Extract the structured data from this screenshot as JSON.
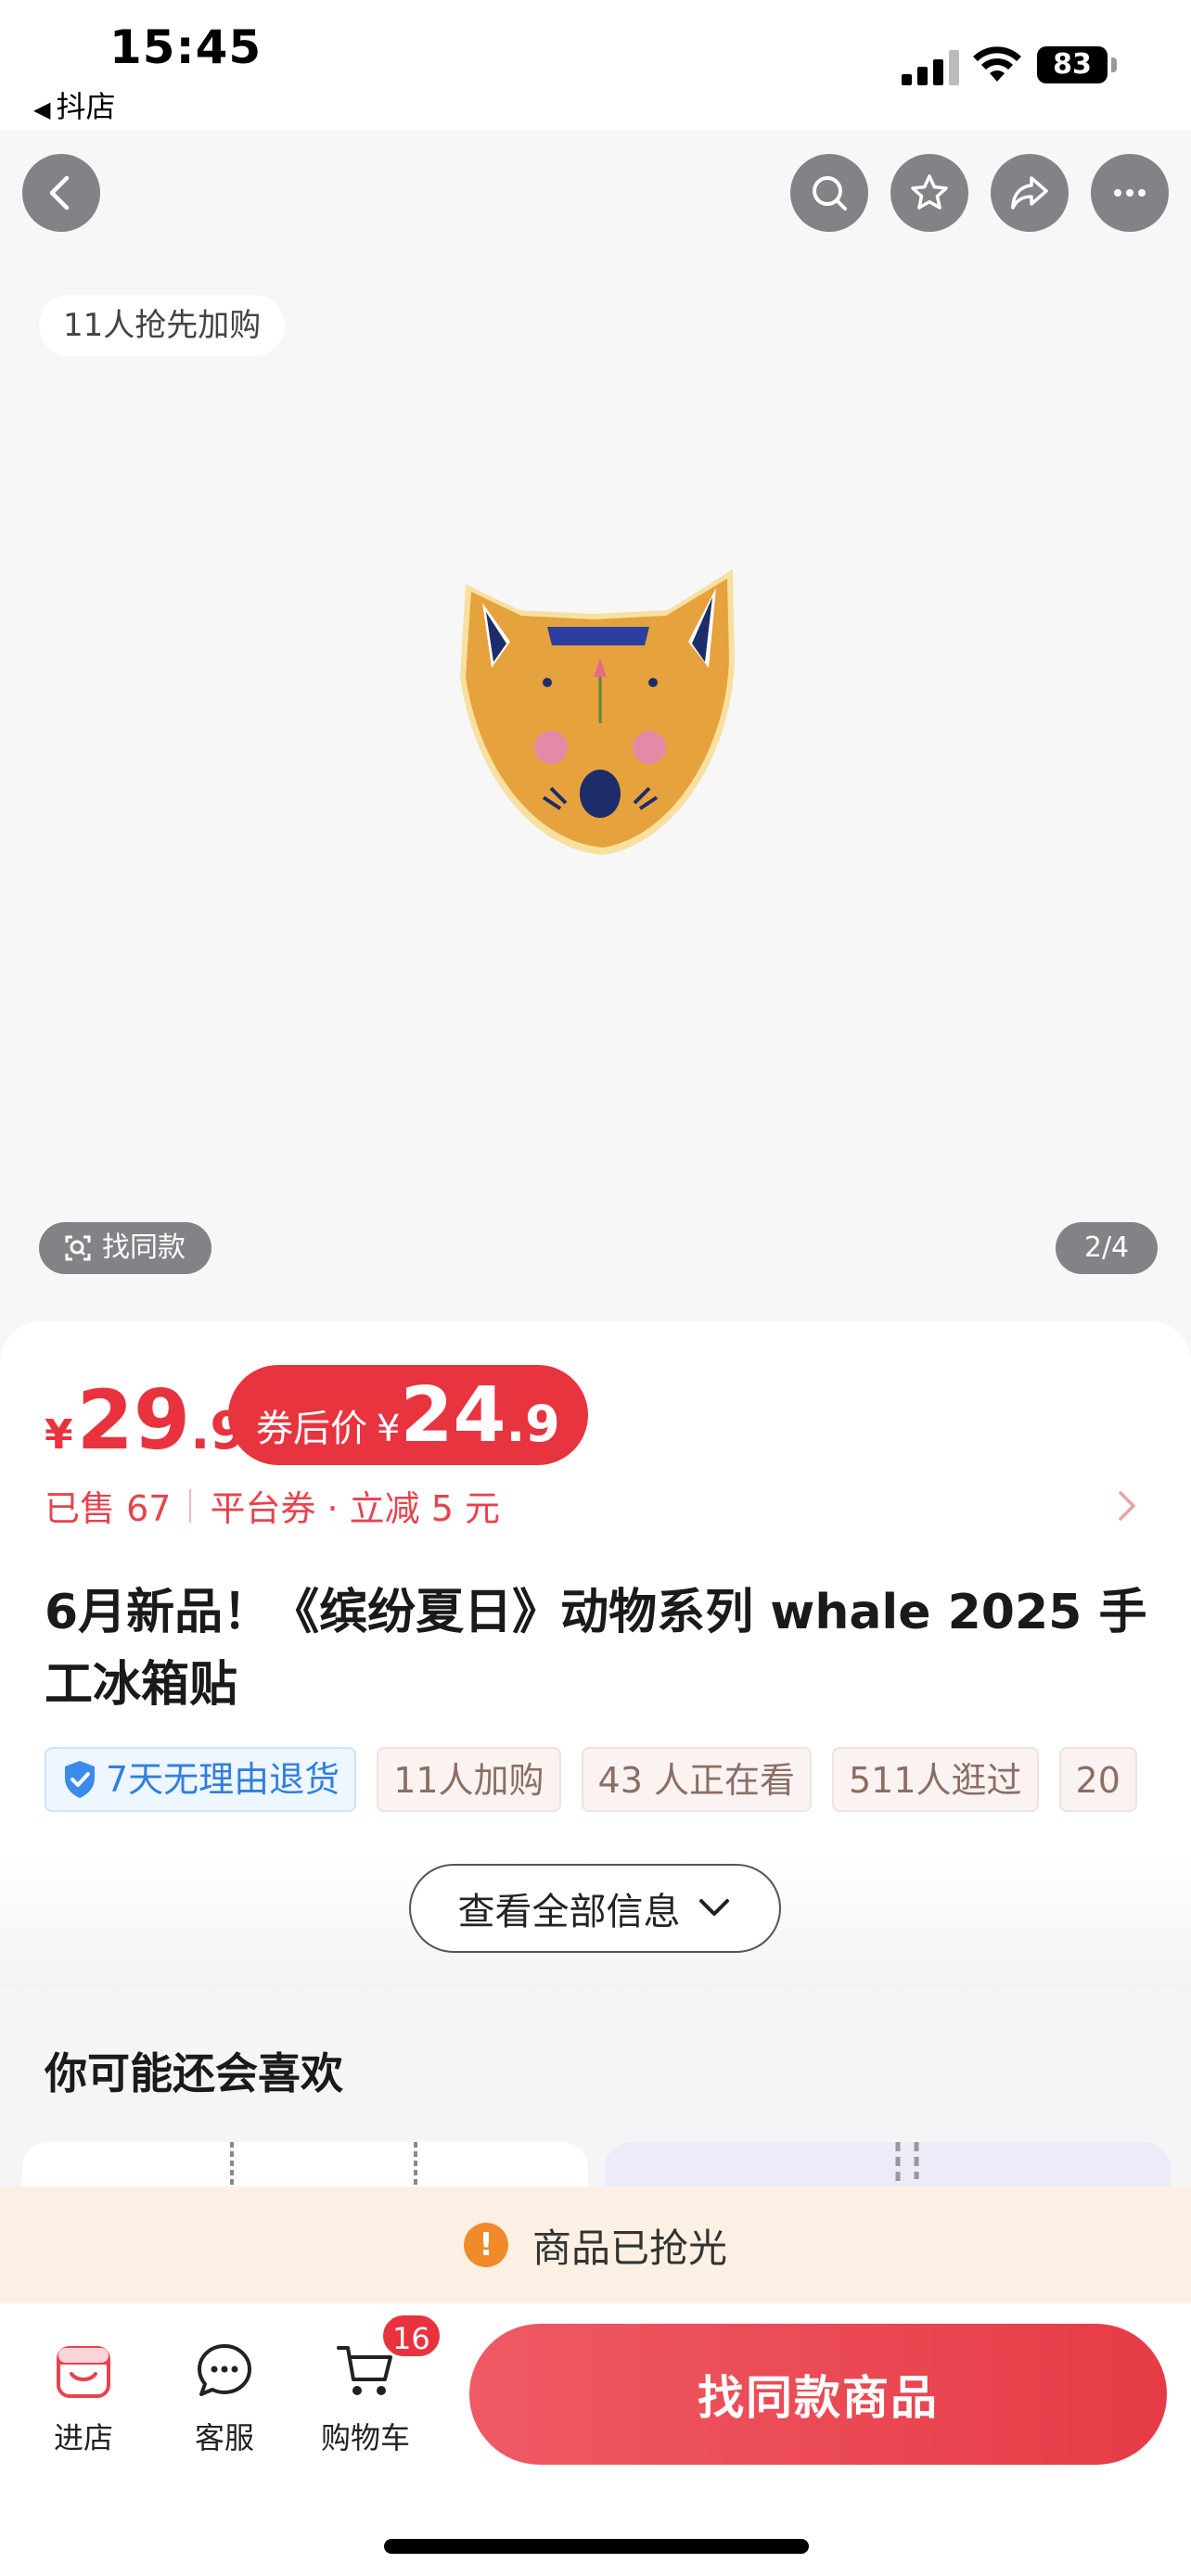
{
  "status_bar": {
    "time": "15:45",
    "back_app": "抖店",
    "battery": "83"
  },
  "hero": {
    "presale_badge": "11人抢先加购",
    "find_same_label": "找同款",
    "pager": "2/4",
    "image_icon": "fox-head-fridge-magnet"
  },
  "price": {
    "currency": "¥",
    "original_int": "29",
    "original_dec": ".9",
    "coupon_label": "券后价",
    "coupon_currency": "¥",
    "coupon_int": "24",
    "coupon_dec": ".9",
    "sold": "已售 67",
    "promo": "平台券 · 立减 5 元"
  },
  "product": {
    "title": "6月新品！《缤纷夏日》动物系列  whale 2025 手工冰箱贴",
    "tags": [
      "7天无理由退货",
      "11人加购",
      "43 人正在看",
      "511人逛过",
      "20"
    ],
    "more_info": "查看全部信息"
  },
  "recommend": {
    "title": "你可能还会喜欢"
  },
  "soldout": {
    "icon": "!",
    "text": "商品已抢光"
  },
  "bottom_nav": {
    "shop": "进店",
    "service": "客服",
    "cart": "购物车",
    "cart_count": "16",
    "cta": "找同款商品"
  },
  "colors": {
    "accent_red": "#e8333e",
    "soldout_bg": "#fbf0e3",
    "warn_orange": "#f08a2a"
  }
}
